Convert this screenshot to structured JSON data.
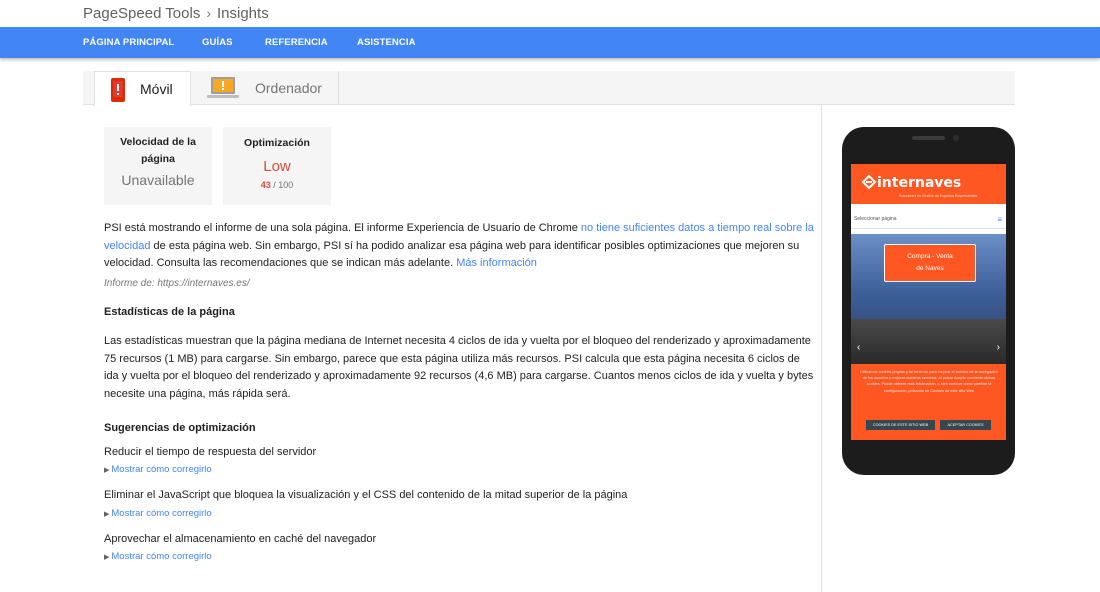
{
  "breadcrumb": {
    "parent": "PageSpeed Tools",
    "separator": "›",
    "current": "Insights"
  },
  "nav": [
    "PÁGINA PRINCIPAL",
    "GUÍAS",
    "REFERENCIA",
    "ASISTENCIA"
  ],
  "tabs": {
    "mobile": "Móvil",
    "desktop": "Ordenador"
  },
  "scores": {
    "speed_label_1": "Velocidad de la",
    "speed_label_2": "página",
    "speed_value": "Unavailable",
    "opt_label": "Optimización",
    "opt_value": "Low",
    "opt_score": "43",
    "opt_max": " / 100"
  },
  "intro": {
    "text1": "PSI está mostrando el informe de una sola página. El informe Experiencia de Usuario de Chrome ",
    "link1": "no tiene suficientes datos a tiempo real sobre la velocidad",
    "text2": " de esta página web. Sin embargo, PSI sí ha podido analizar esa página web para identificar posibles optimizaciones que mejoren su velocidad. Consulta las recomendaciones que se indican más adelante. ",
    "link2": "Más información"
  },
  "report_url": "Informe de: https://internaves.es/",
  "stats": {
    "title": "Estadísticas de la página",
    "body": "Las estadísticas muestran que la página mediana de Internet necesita 4 ciclos de ida y vuelta por el bloqueo del renderizado y aproximadamente 75 recursos (1 MB) para cargarse. Sin embargo, parece que esta página utiliza más recursos. PSI calcula que esta página necesita 6 ciclos de ida y vuelta por el bloqueo del renderizado y aproximadamente 92 recursos (4,6 MB) para cargarse. Cuantos menos ciclos de ida y vuelta y bytes necesite una página, más rápida será."
  },
  "suggestions": {
    "title": "Sugerencias de optimización",
    "items": [
      {
        "title": "Reducir el tiempo de respuesta del servidor",
        "link": "Mostrar cómo corregirlo"
      },
      {
        "title": "Eliminar el JavaScript que bloquea la visualización y el CSS del contenido de la mitad superior de la página",
        "link": "Mostrar cómo corregirlo"
      },
      {
        "title": "Aprovechar el almacenamiento en caché del navegador",
        "link": "Mostrar cómo corregirlo"
      }
    ]
  },
  "phone_preview": {
    "logo": "internaves",
    "tagline": "Soluciones en Gestión de Espacios Empresariales",
    "menu": "Seleccionar página",
    "hero_line1": "Compra - Venta",
    "hero_line2": "de Naves",
    "cookie_text": "Utilizamos cookies propias y de terceros para mejorar el análisis de la navegación de los usuarios y mejorar nuestros servicios. Al pulsar Acepto consiente dichas cookies. Puede obtener más información, o bien conocer cómo cambiar la configuración, pulsando en Cookies de este sitio Web",
    "cookie_btn1": "COOKIES DE ESTE SITIO WEB",
    "cookie_btn2": "ACEPTAR COOKIES"
  },
  "colors": {
    "nav": "#4285f4",
    "low_score": "#dd4b39",
    "link": "#4285f4",
    "site_accent": "#ff5722"
  },
  "icons": {
    "mobile_tab": "mobile-phone-warning-icon",
    "desktop_tab": "laptop-warning-icon",
    "breadcrumb_sep": "chevron-right-icon"
  }
}
